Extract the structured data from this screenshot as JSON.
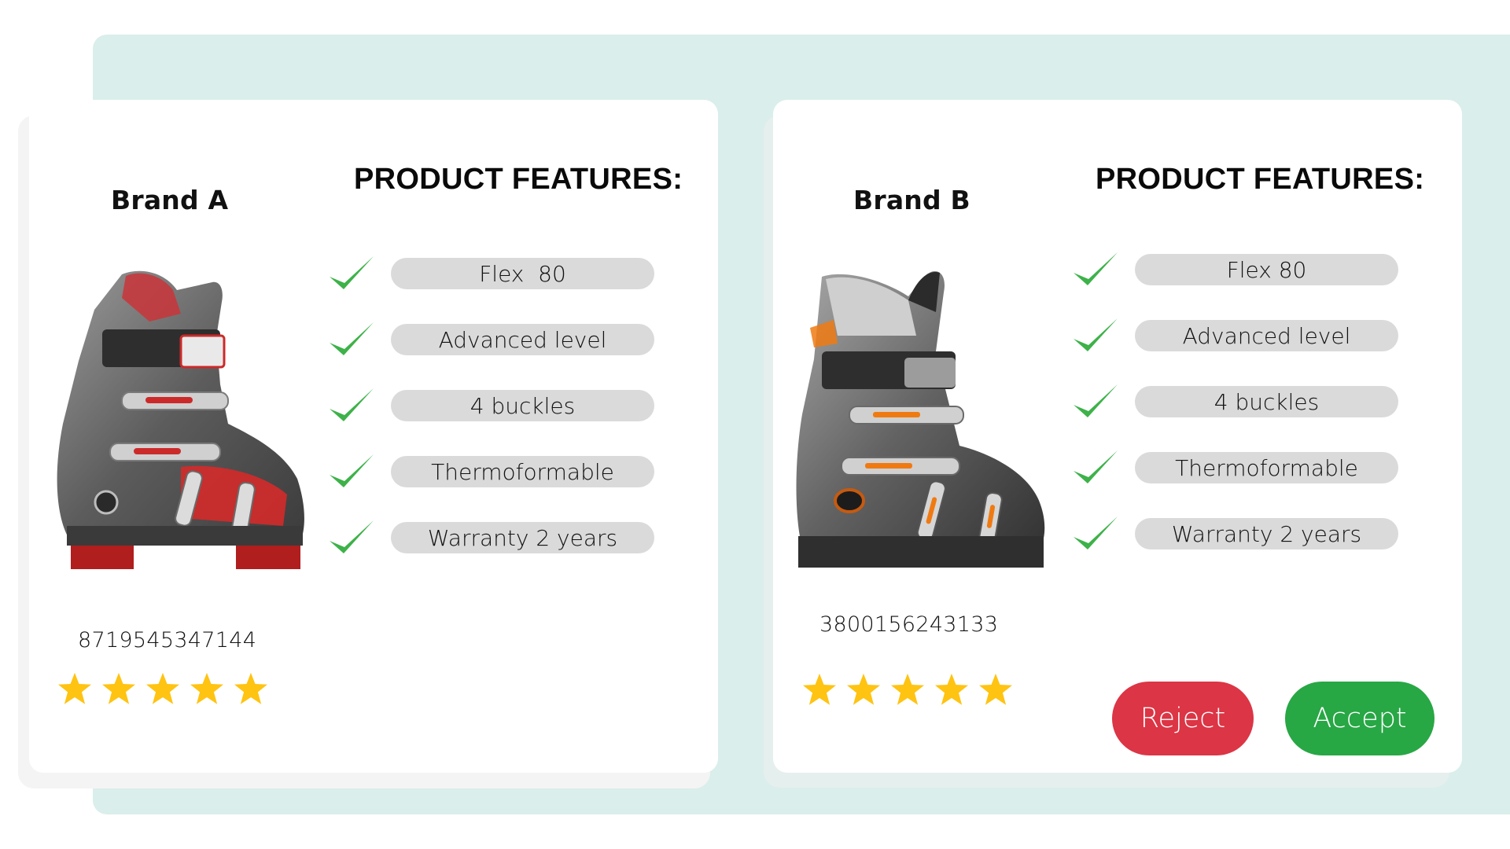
{
  "colors": {
    "panel_bg": "#DAEEEB",
    "pill_bg": "#DADADA",
    "check_green": "#3DB249",
    "star_yellow": "#FFC312",
    "reject": "#DC3545",
    "accept": "#28A745"
  },
  "products": [
    {
      "brand": "Brand A",
      "features_title": "PRODUCT FEATURES:",
      "features": [
        "Flex  80",
        "Advanced level",
        "4 buckles",
        "Thermoformable",
        "Warranty 2 years"
      ],
      "ean": "8719545347144",
      "rating": 5,
      "rating_max": 5,
      "image": "red-grey-ski-boot",
      "accent": "#D42A2A"
    },
    {
      "brand": "Brand B",
      "features_title": "PRODUCT FEATURES:",
      "features": [
        "Flex 80",
        "Advanced level",
        "4 buckles",
        "Thermoformable",
        "Warranty 2 years"
      ],
      "ean": "3800156243133",
      "rating": 5,
      "rating_max": 5,
      "image": "grey-orange-ski-boot",
      "accent": "#F07A12"
    }
  ],
  "actions": {
    "reject_label": "Reject",
    "accept_label": "Accept"
  }
}
